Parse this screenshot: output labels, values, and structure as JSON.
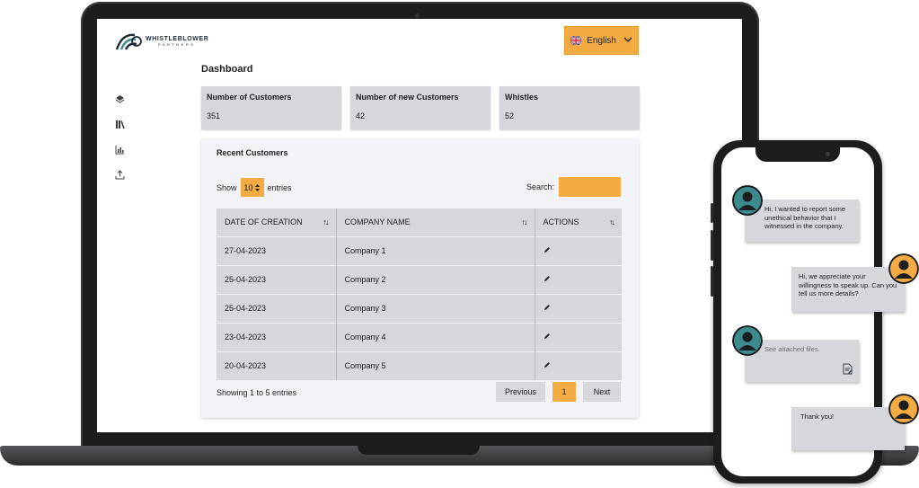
{
  "brand": {
    "name": "WHISTLEBLOWER",
    "sub": "PARTNERS"
  },
  "language": {
    "label": "English",
    "flag": "uk-flag-icon"
  },
  "sidebar": {
    "icons": [
      "layers-icon",
      "library-icon",
      "chart-icon",
      "upload-icon"
    ]
  },
  "dashboard": {
    "title": "Dashboard",
    "stats": [
      {
        "label": "Number of Customers",
        "value": "351"
      },
      {
        "label": "Number of new Customers",
        "value": "42"
      },
      {
        "label": "Whistles",
        "value": "52"
      }
    ]
  },
  "recent": {
    "title": "Recent Customers",
    "show_label": "Show",
    "entries_value": "10",
    "entries_label": "entries",
    "search_label": "Search:",
    "columns": [
      "DATE OF CREATION",
      "COMPANY NAME",
      "ACTIONS"
    ],
    "rows": [
      {
        "date": "27-04-2023",
        "company": "Company 1"
      },
      {
        "date": "25-04-2023",
        "company": "Company 2"
      },
      {
        "date": "25-04-2023",
        "company": "Company 3"
      },
      {
        "date": "23-04-2023",
        "company": "Company 4"
      },
      {
        "date": "20-04-2023",
        "company": "Company 5"
      }
    ],
    "showing": "Showing 1 to 5 entries",
    "pager": {
      "previous": "Previous",
      "page": "1",
      "next": "Next"
    }
  },
  "chat": {
    "messages": [
      {
        "from": "whistleblower",
        "text": "Hi, I wanted to report some unethical behavior that I witnessed in the company."
      },
      {
        "from": "partner",
        "text": "Hi, we appreciate your willingness to speak up. Can you tell us more details?"
      },
      {
        "from": "whistleblower",
        "text": "See attached files."
      },
      {
        "from": "partner",
        "text": "Thank you!"
      }
    ]
  },
  "colors": {
    "accent": "#f4ab43",
    "card": "#d6d7da",
    "avatar_teal": "#3c8c8f",
    "avatar_orange": "#f4ab43"
  }
}
